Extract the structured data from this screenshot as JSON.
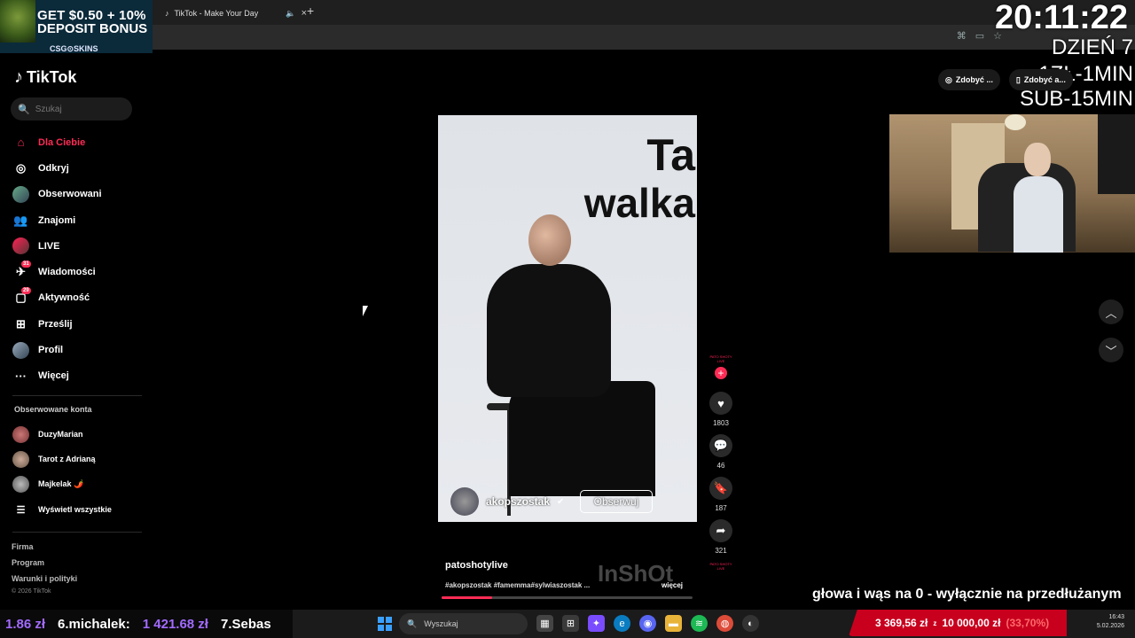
{
  "promo": {
    "line1": "GET $0.50 + 10%",
    "line2": "DEPOSIT BONUS",
    "brand": "CSG⊙SKINS"
  },
  "browser": {
    "tab_title": "TikTok - Make Your Day",
    "close": "×",
    "new_tab": "+"
  },
  "overlay": {
    "clock": "20:11:22",
    "day": "DZIEŃ 7",
    "rate": "1ZŁ-1MIN",
    "sub": "SUB-15MIN",
    "marquee": "głowa i wąs na 0 - wyłącznie na przedłużanym"
  },
  "sidebar": {
    "logo": "TikTok",
    "search_placeholder": "Szukaj",
    "items": [
      {
        "label": "Dla Ciebie",
        "icon": "home-icon",
        "active": true
      },
      {
        "label": "Odkryj",
        "icon": "compass-icon"
      },
      {
        "label": "Obserwowani",
        "icon": "avatar"
      },
      {
        "label": "Znajomi",
        "icon": "friends-icon"
      },
      {
        "label": "LIVE",
        "icon": "live-icon"
      },
      {
        "label": "Wiadomości",
        "icon": "messages-icon",
        "badge": "31"
      },
      {
        "label": "Aktywność",
        "icon": "activity-icon",
        "badge": "29"
      },
      {
        "label": "Prześlij",
        "icon": "upload-icon"
      },
      {
        "label": "Profil",
        "icon": "profile-icon"
      },
      {
        "label": "Więcej",
        "icon": "more-icon"
      }
    ],
    "following_title": "Obserwowane konta",
    "accounts": [
      "DuzyMarian",
      "Tarot z Adrianą",
      "Majkelak 🌶️"
    ],
    "show_all": "Wyświetl wszystkie",
    "footer": [
      "Firma",
      "Program",
      "Warunki i polityki"
    ],
    "copyright": "© 2026 TikTok"
  },
  "topbar": {
    "coins": "Zdobyć ...",
    "app": "Zdobyć a..."
  },
  "video": {
    "text_line1": "Ta",
    "text_line2": "walka",
    "username": "akopszostak",
    "follow": "Obserwuj",
    "caption_user": "patoshotylive",
    "caption_tags": "#akopszostak #famemma#sylwiaszostak ...",
    "more": "więcej",
    "watermark": "InShOt",
    "progress": 0.2
  },
  "actions": {
    "likes": "1803",
    "comments": "46",
    "saves": "187",
    "shares": "321"
  },
  "leaderboard": {
    "prev_amount": "1.86 zł",
    "name6": "6.michalek:",
    "amount6": "1 421.68 zł",
    "name7": "7.Sebas"
  },
  "donation": {
    "current": "3 369,56 zł",
    "sep": "z",
    "goal": "10 000,00 zł",
    "pct": "(33,70%)"
  },
  "taskbar": {
    "search": "Wyszukaj",
    "time": "16:43",
    "date": "5.02.2026"
  }
}
